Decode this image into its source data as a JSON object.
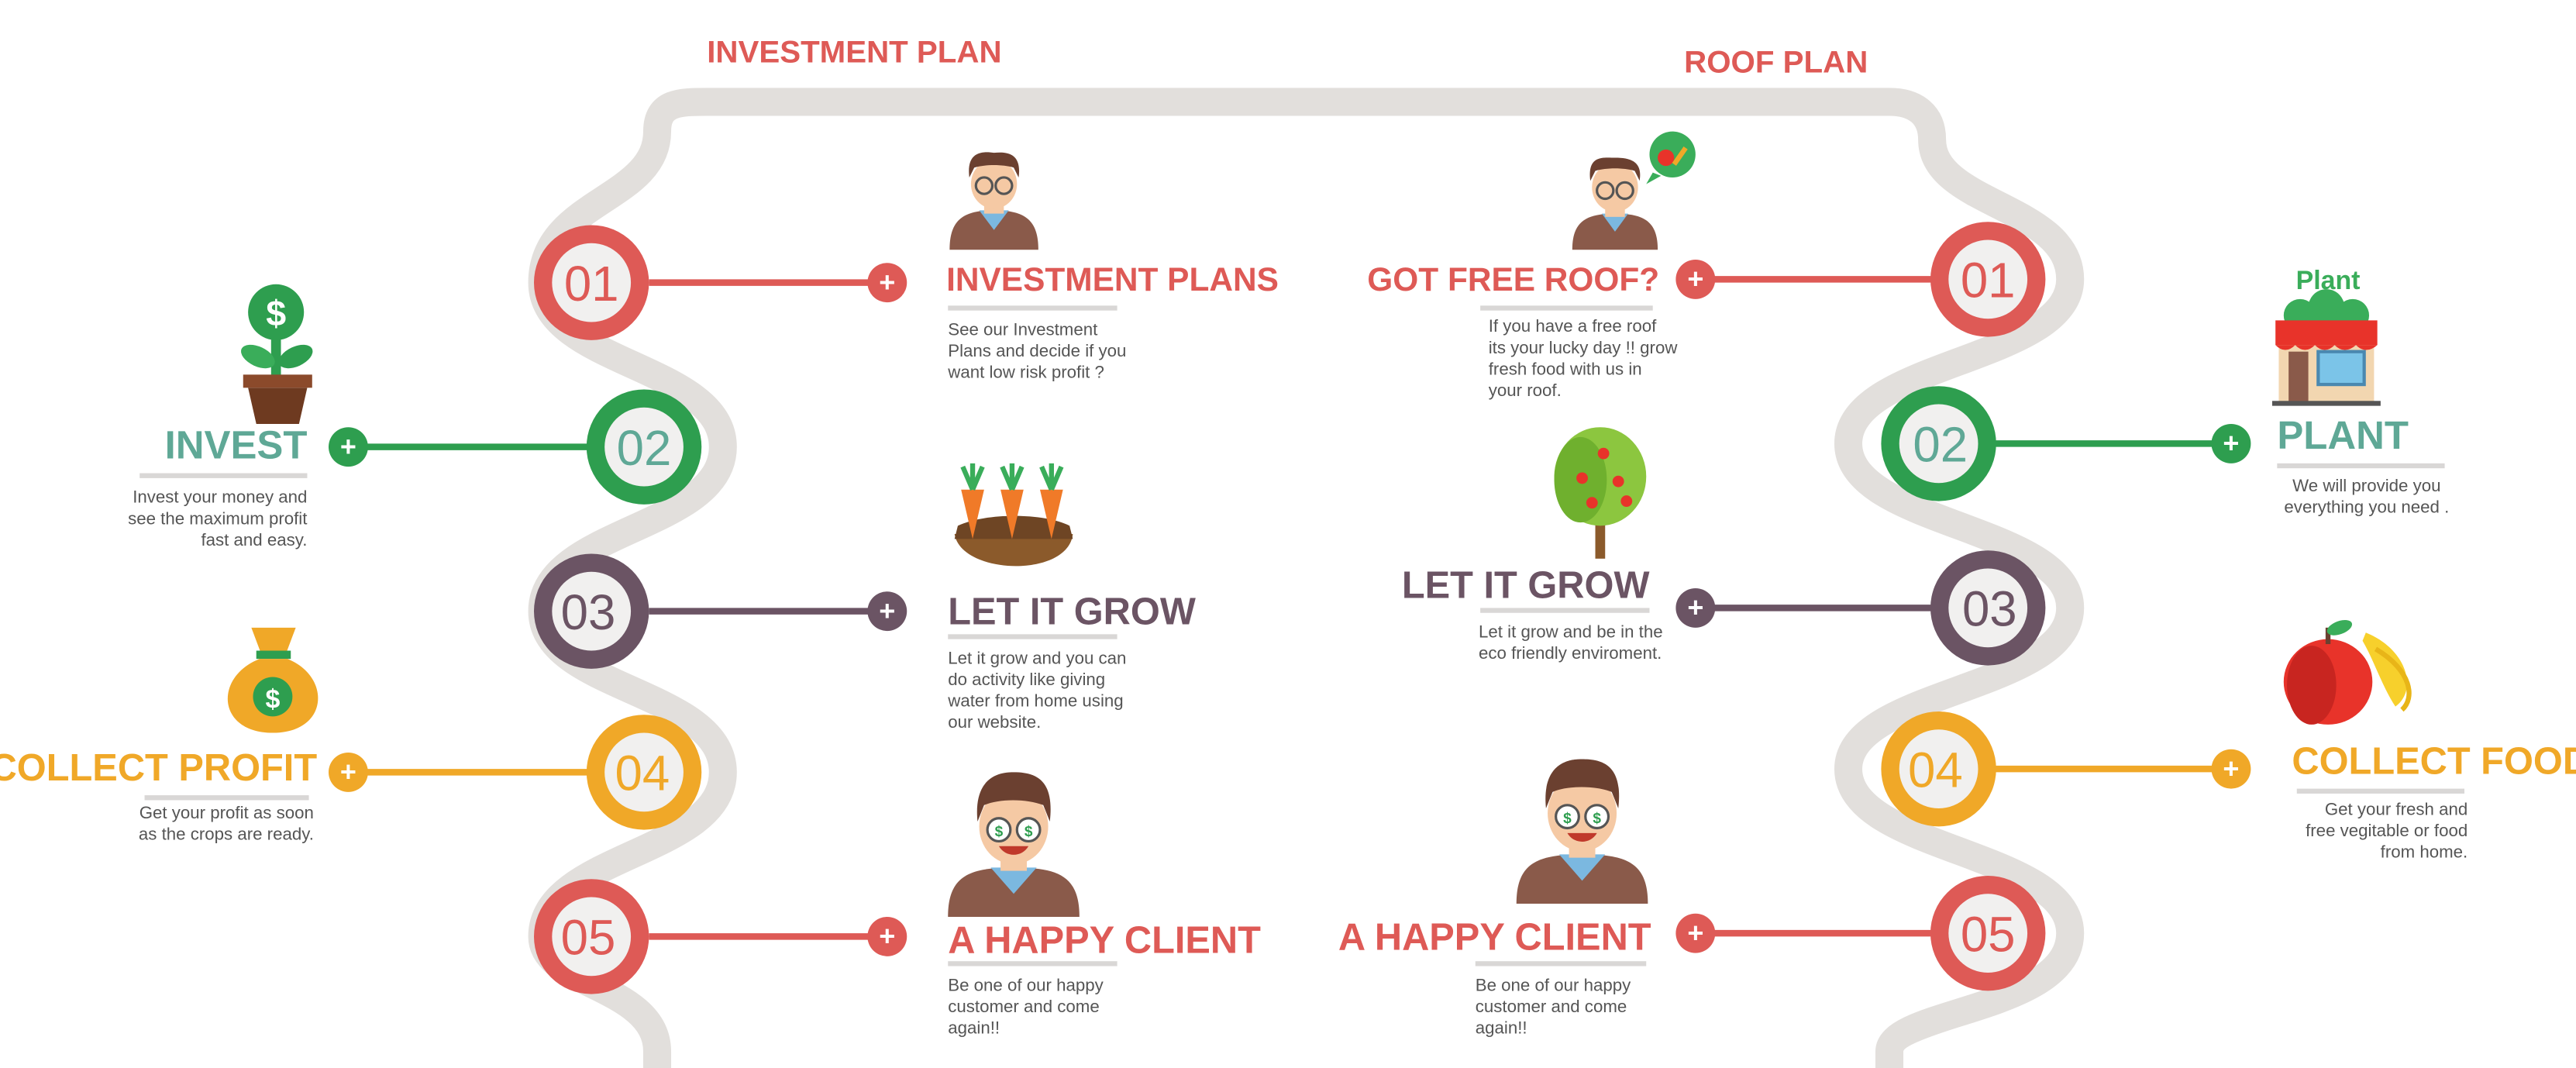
{
  "colors": {
    "red": "#de5a56",
    "green": "#2e9e4f",
    "purple": "#6b5464",
    "orange": "#f0a828",
    "track": "#e2dfdc",
    "teal_text": "#5fa896"
  },
  "investment_plan": {
    "title": "INVESTMENT PLAN",
    "steps": [
      {
        "number": "01",
        "color": "red",
        "heading": "INVESTMENT PLANS",
        "text": "See our Investment Plans and decide if you want low risk profit ?",
        "icon": "man-with-glasses-icon"
      },
      {
        "number": "02",
        "color": "green",
        "heading": "INVEST",
        "text": "Invest your money and see the maximum profit fast and easy.",
        "icon": "money-plant-icon"
      },
      {
        "number": "03",
        "color": "purple",
        "heading": "LET IT GROW",
        "text": "Let it grow and you can do activity like giving water from home using our website.",
        "icon": "carrots-icon"
      },
      {
        "number": "04",
        "color": "orange",
        "heading": "COLLECT PROFIT",
        "text": "Get your profit as soon as the crops are ready.",
        "icon": "money-bag-icon"
      },
      {
        "number": "05",
        "color": "red",
        "heading": "A HAPPY CLIENT",
        "text": "Be one of our happy customer and come again!!",
        "icon": "happy-client-icon"
      }
    ]
  },
  "roof_plan": {
    "title": "ROOF PLAN",
    "steps": [
      {
        "number": "01",
        "color": "red",
        "heading": "GOT FREE ROOF?",
        "text": "If you have a free roof its your lucky day !! grow fresh food with us in your roof.",
        "icon": "man-thinking-icon"
      },
      {
        "number": "02",
        "color": "green",
        "heading": "PLANT",
        "text": "We will provide you everything you need .",
        "icon": "shop-icon",
        "icon_label": "Plant"
      },
      {
        "number": "03",
        "color": "purple",
        "heading": "LET IT GROW",
        "text": "Let it grow and be in the eco friendly enviroment.",
        "icon": "tree-icon"
      },
      {
        "number": "04",
        "color": "orange",
        "heading": "COLLECT FOOD",
        "text": "Get your fresh and free vegitable or food from home.",
        "icon": "fruits-icon"
      },
      {
        "number": "05",
        "color": "red",
        "heading": "A HAPPY CLIENT",
        "text": "Be one of our happy customer and come again!!",
        "icon": "happy-client-icon"
      }
    ]
  }
}
